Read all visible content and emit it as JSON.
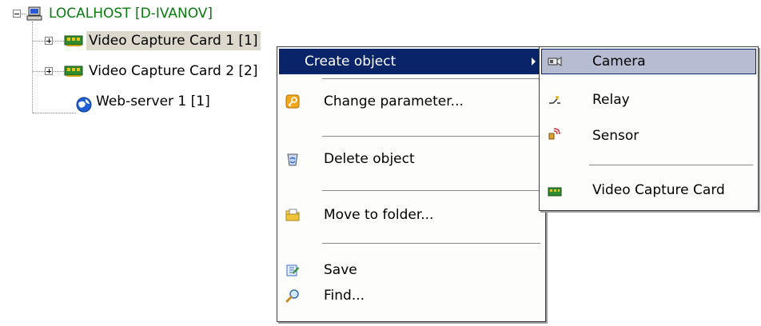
{
  "tree": {
    "root": {
      "label": "LOCALHOST [D-IVANOV]",
      "icon": "computer-icon"
    },
    "nodes": [
      {
        "label": "Video Capture Card 1 [1]",
        "icon": "capture-card-icon",
        "expander": "plus",
        "selected": true
      },
      {
        "label": "Video Capture Card 2 [2]",
        "icon": "capture-card-icon",
        "expander": "plus"
      },
      {
        "label": "Web-server 1 [1]",
        "icon": "web-server-icon"
      }
    ]
  },
  "context_menu": {
    "items": [
      {
        "label": "Create object",
        "has_submenu": true,
        "highlighted": true
      },
      {
        "label": "Change parameter...",
        "icon": "key-icon"
      },
      {
        "label": "Delete object",
        "icon": "delete-icon"
      },
      {
        "label": "Move to folder...",
        "icon": "folder-icon"
      },
      {
        "label": "Save",
        "icon": "save-icon"
      },
      {
        "label": "Find...",
        "icon": "magnifier-icon"
      }
    ]
  },
  "submenu": {
    "items": [
      {
        "label": "Camera",
        "icon": "camera-icon",
        "highlighted": true
      },
      {
        "label": "Relay",
        "icon": "relay-icon"
      },
      {
        "label": "Sensor",
        "icon": "sensor-icon"
      },
      {
        "label": "Video Capture Card",
        "icon": "capture-card-icon"
      }
    ]
  },
  "colors": {
    "menu_highlight": "#0a246a",
    "submenu_highlight": "#b6bdd2",
    "root_text": "#0a7a10"
  }
}
